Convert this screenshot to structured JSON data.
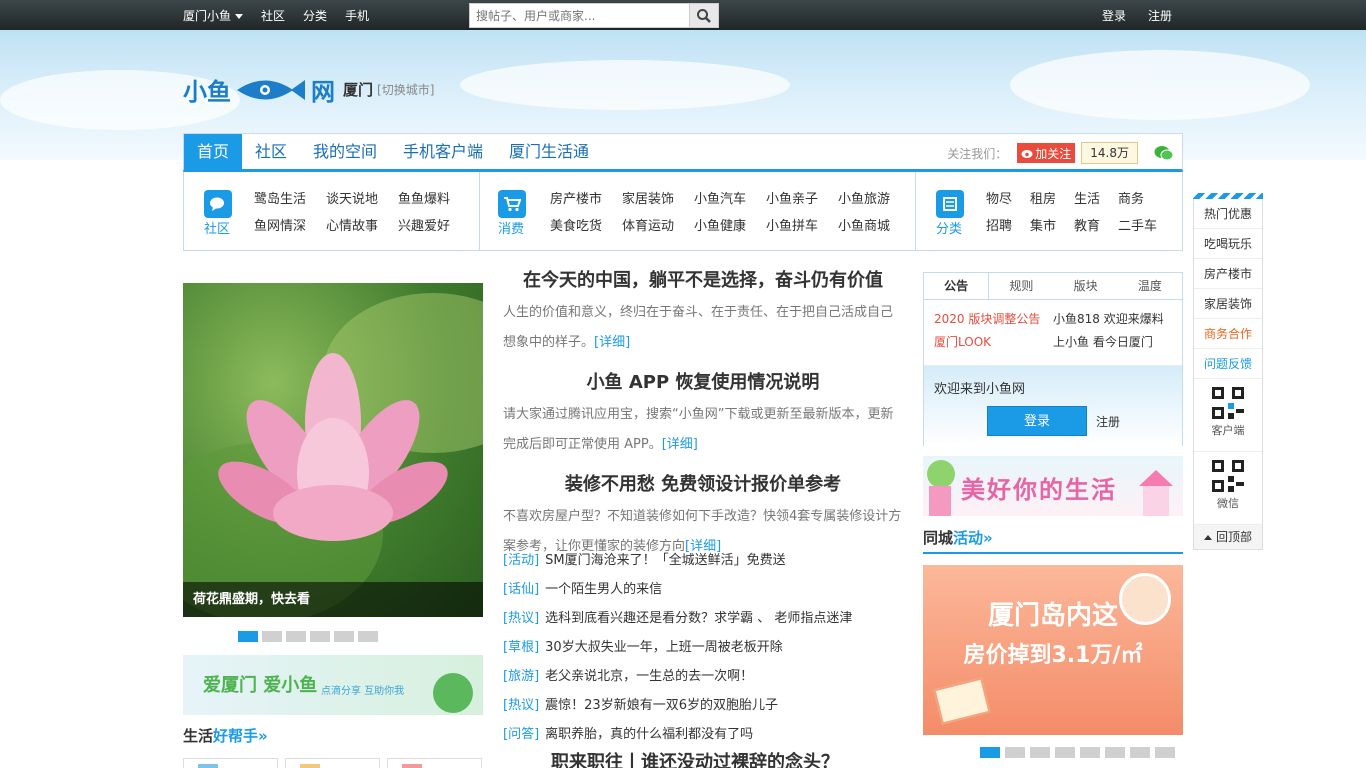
{
  "topbar": {
    "city_menu": "厦门小鱼",
    "nav": [
      "社区",
      "分类",
      "手机"
    ],
    "search_placeholder": "搜帖子、用户或商家...",
    "login": "登录",
    "register": "注册"
  },
  "logo": {
    "text_left": "小鱼",
    "text_right": "网",
    "domain": "xiaoyu.com",
    "city": "厦门",
    "switch_city": "[切换城市]"
  },
  "mainnav": {
    "items": [
      "首页",
      "社区",
      "我的空间",
      "手机客户端",
      "厦门生活通"
    ],
    "follow_label": "关注我们：",
    "weibo_follow": "加关注",
    "follower_count": "14.8万"
  },
  "subnav": {
    "community": {
      "label": "社区",
      "links": [
        "鹭岛生活",
        "谈天说地",
        "鱼鱼爆料",
        "鱼网情深",
        "心情故事",
        "兴趣爱好"
      ]
    },
    "consume": {
      "label": "消费",
      "links": [
        "房产楼市",
        "家居装饰",
        "小鱼汽车",
        "小鱼亲子",
        "小鱼旅游",
        "美食吃货",
        "体育运动",
        "小鱼健康",
        "小鱼拼车",
        "小鱼商城"
      ]
    },
    "category": {
      "label": "分类",
      "links": [
        "物尽",
        "租房",
        "生活",
        "商务",
        "招聘",
        "集市",
        "教育",
        "二手车"
      ]
    }
  },
  "slider": {
    "caption": "荷花鼎盛期，快去看",
    "slide_count": 6,
    "active_index": 0
  },
  "banner1": {
    "text": "爱厦门 爱小鱼",
    "sub": "点滴分享 互助你我"
  },
  "helper": {
    "prefix": "生活",
    "title": "好帮手»"
  },
  "articles": [
    {
      "title": "在今天的中国，躺平不是选择，奋斗仍有价值",
      "body": "人生的价值和意义，终归在于奋斗、在于责任、在于把自己活成自己想象中的样子。",
      "more": "[详细]"
    },
    {
      "title": "小鱼 APP 恢复使用情况说明",
      "body": "请大家通过腾讯应用宝，搜索“小鱼网”下载或更新至最新版本，更新完成后即可正常使用 APP。",
      "more": "[详细]"
    },
    {
      "title": "装修不用愁 免费领设计报价单参考",
      "body": "不喜欢房屋户型？不知道装修如何下手改造？快领4套专属装修设计方案参考，让你更懂家的装修方向",
      "more": "[详细]"
    }
  ],
  "list": [
    {
      "tag": "[活动]",
      "text": "SM厦门海沧来了！「全城送鲜活」免费送"
    },
    {
      "tag": "[话仙]",
      "text": "一个陌生男人的来信"
    },
    {
      "tag": "[热议]",
      "text": "选科到底看兴趣还是看分数？求学霸 、 老师指点迷津"
    },
    {
      "tag": "[草根]",
      "text": "30岁大叔失业一年，上班一周被老板开除"
    },
    {
      "tag": "[旅游]",
      "text": "老父亲说北京，一生总的去一次啊！"
    },
    {
      "tag": "[热议]",
      "text": "震惊！23岁新娘有一双6岁的双胞胎儿子"
    },
    {
      "tag": "[问答]",
      "text": "离职养胎，真的什么福利都没有了吗"
    }
  ],
  "bighead": "职来职往丨谁还没动过裸辞的念头？",
  "notice": {
    "tabs": [
      "公告",
      "规则",
      "版块",
      "温度"
    ],
    "items": [
      "2020 版块调整公告",
      "小鱼818 欢迎来爆料",
      "厦门LOOK",
      "上小鱼 看今日厦门"
    ],
    "welcome": "欢迎来到小鱼网",
    "login": "登录",
    "register": "注册"
  },
  "banner2": {
    "text": "美好你的生活"
  },
  "tongcheng": {
    "prefix": "同城",
    "title": "活动»"
  },
  "banner3": {
    "line1": "厦门岛内这",
    "line2": "房价掉到3.1万/㎡",
    "slide_count": 8,
    "active_index": 0
  },
  "sidebar": {
    "items": [
      "热门优惠",
      "吃喝玩乐",
      "房产楼市",
      "家居装饰",
      "商务合作",
      "问题反馈"
    ],
    "qr1": "客户端",
    "qr2": "微信",
    "back_top": "回顶部"
  },
  "colors": {
    "accent": "#1b9be6",
    "red": "#e94b3c",
    "orange": "#e8671b"
  }
}
